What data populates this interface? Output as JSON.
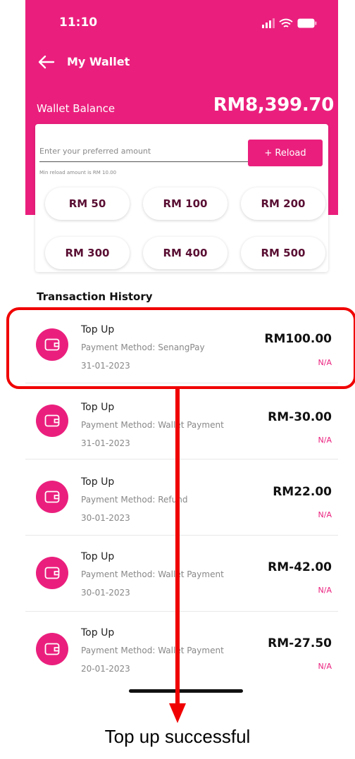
{
  "status_bar": {
    "time": "11:10"
  },
  "nav": {
    "title": "My Wallet",
    "back_icon": "arrow-left-icon"
  },
  "wallet": {
    "balance_label": "Wallet Balance",
    "balance_value": "RM8,399.70"
  },
  "reload": {
    "placeholder": "Enter your preferred amount",
    "value": "",
    "hint": "Min reload amount is RM 10.00",
    "button_label": "+ Reload",
    "presets": [
      "RM 50",
      "RM 100",
      "RM 200",
      "RM 300",
      "RM 400",
      "RM 500"
    ]
  },
  "history": {
    "title": "Transaction History",
    "icon": "wallet-icon",
    "transactions": [
      {
        "title": "Top Up",
        "method": "Payment Method: SenangPay",
        "date": "31-01-2023",
        "amount": "RM100.00",
        "status": "N/A"
      },
      {
        "title": "Top Up",
        "method": "Payment Method: Wallet Payment",
        "date": "31-01-2023",
        "amount": "RM-30.00",
        "status": "N/A"
      },
      {
        "title": "Top Up",
        "method": "Payment Method: Refund",
        "date": "30-01-2023",
        "amount": "RM22.00",
        "status": "N/A"
      },
      {
        "title": "Top Up",
        "method": "Payment Method: Wallet Payment",
        "date": "30-01-2023",
        "amount": "RM-42.00",
        "status": "N/A"
      },
      {
        "title": "Top Up",
        "method": "Payment Method: Wallet Payment",
        "date": "20-01-2023",
        "amount": "RM-27.50",
        "status": "N/A"
      }
    ]
  },
  "annotation": {
    "caption": "Top up successful"
  },
  "colors": {
    "brand_pink": "#ea1f7d",
    "annotation_red": "#f00000",
    "preset_text": "#5a0f33"
  }
}
